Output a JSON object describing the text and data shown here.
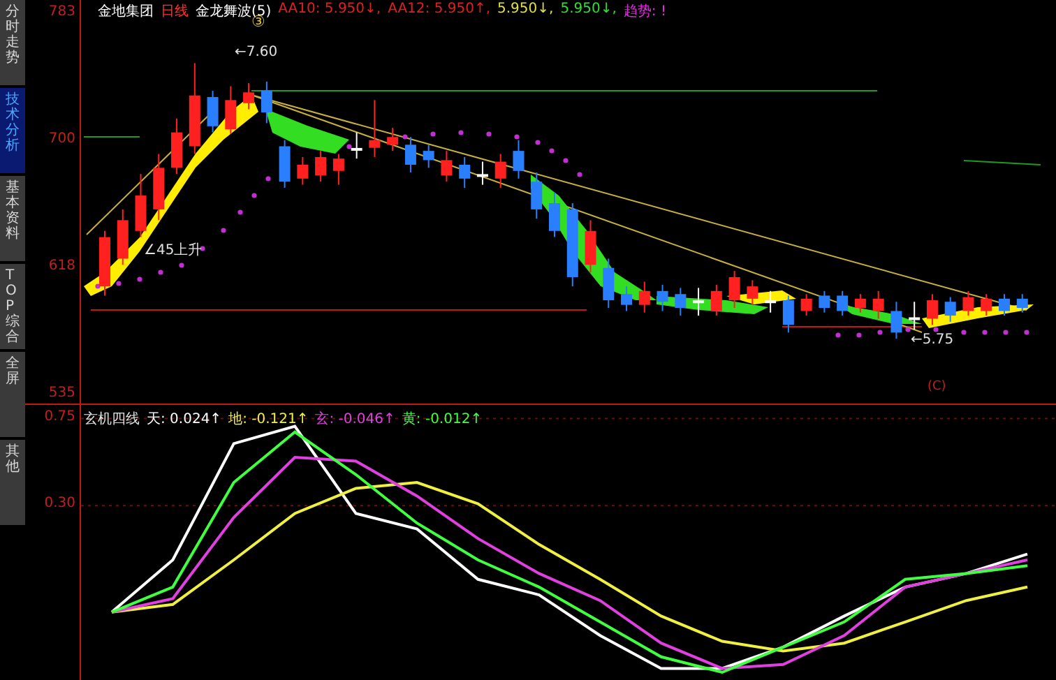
{
  "sidebar": {
    "tabs": [
      {
        "label": "分时走势",
        "selected": false
      },
      {
        "label": "技术分析",
        "selected": true
      },
      {
        "label": "基本资料",
        "selected": false
      },
      {
        "label": "TOP综合",
        "selected": false
      },
      {
        "label": "全屏",
        "selected": false
      },
      {
        "label": "其他",
        "selected": false
      }
    ]
  },
  "main_chart": {
    "header": [
      {
        "text": "金地集团",
        "color": "#ffffff"
      },
      {
        "text": "日线",
        "color": "#ff3030"
      },
      {
        "text": "金龙舞波(5)",
        "color": "#ffffff"
      },
      {
        "text": "AA10: 5.950↓,",
        "color": "#e02020"
      },
      {
        "text": "AA12: 5.950↑,",
        "color": "#e02020"
      },
      {
        "text": "5.950↓,",
        "color": "#e0e040"
      },
      {
        "text": "5.950↓,",
        "color": "#30e030"
      },
      {
        "text": "趋势: !",
        "color": "#e030e0"
      }
    ],
    "marker": "③",
    "annotations": [
      "←7.60",
      "∠45上升",
      "←5.75",
      "(C)"
    ],
    "chart_data": {
      "type": "candlestick",
      "ylim": [
        529,
        792
      ],
      "yticks": [
        {
          "value": 783,
          "label": "783"
        },
        {
          "value": 700,
          "label": "700"
        },
        {
          "value": 618,
          "label": "618"
        },
        {
          "value": 535,
          "label": "535"
        }
      ],
      "ohlc": [
        [
          606,
          642,
          600,
          638
        ],
        [
          624,
          656,
          620,
          649
        ],
        [
          642,
          679,
          638,
          665
        ],
        [
          656,
          692,
          649,
          683
        ],
        [
          683,
          715,
          679,
          706
        ],
        [
          697,
          751,
          692,
          730
        ],
        [
          729,
          733,
          706,
          710
        ],
        [
          708,
          736,
          705,
          727
        ],
        [
          725,
          738,
          721,
          732
        ],
        [
          733,
          739,
          712,
          719
        ],
        [
          697,
          701,
          670,
          674
        ],
        [
          676,
          690,
          672,
          685
        ],
        [
          678,
          694,
          674,
          690
        ],
        [
          681,
          692,
          672,
          689
        ],
        [
          695,
          706,
          689,
          695
        ],
        [
          696,
          727,
          690,
          701
        ],
        [
          698,
          709,
          694,
          703
        ],
        [
          698,
          703,
          680,
          685
        ],
        [
          694,
          698,
          683,
          688
        ],
        [
          678,
          694,
          674,
          688
        ],
        [
          685,
          690,
          670,
          676
        ],
        [
          678,
          687,
          672,
          678
        ],
        [
          676,
          692,
          670,
          687
        ],
        [
          694,
          701,
          676,
          681
        ],
        [
          674,
          680,
          650,
          656
        ],
        [
          660,
          667,
          638,
          642
        ],
        [
          656,
          660,
          606,
          612
        ],
        [
          620,
          649,
          615,
          642
        ],
        [
          618,
          624,
          592,
          597
        ],
        [
          601,
          606,
          590,
          594
        ],
        [
          594,
          609,
          589,
          603
        ],
        [
          603,
          607,
          590,
          596
        ],
        [
          601,
          605,
          587,
          592
        ],
        [
          596,
          605,
          587,
          596
        ],
        [
          590,
          607,
          587,
          603
        ],
        [
          597,
          616,
          592,
          612
        ],
        [
          598,
          610,
          594,
          606
        ],
        [
          596,
          603,
          589,
          596
        ],
        [
          597,
          600,
          576,
          581
        ],
        [
          590,
          601,
          587,
          598
        ],
        [
          600,
          603,
          589,
          592
        ],
        [
          600,
          603,
          587,
          590
        ],
        [
          592,
          601,
          589,
          598
        ],
        [
          590,
          603,
          585,
          598
        ],
        [
          590,
          596,
          572,
          576
        ],
        [
          585,
          596,
          578,
          585
        ],
        [
          585,
          601,
          581,
          597
        ],
        [
          596,
          599,
          583,
          587
        ],
        [
          590,
          603,
          587,
          599
        ],
        [
          590,
          601,
          587,
          598
        ],
        [
          598,
          601,
          587,
          590
        ],
        [
          598,
          601,
          589,
          592
        ]
      ]
    }
  },
  "indicator": {
    "title": "玄机四线",
    "legend": [
      ": 0.024↑",
      ": -0.121↑",
      ": -0.046↑",
      ": -0.012↑"
    ],
    "chart_data": {
      "type": "line",
      "ylim": [
        -0.6,
        0.82
      ],
      "yticks": [
        {
          "value": 0.75,
          "label": "0.75"
        },
        {
          "value": 0.3,
          "label": "0.30"
        }
      ],
      "series": [
        {
          "name": "天",
          "color": "#ffffff",
          "values": [
            -0.25,
            0.02,
            0.62,
            0.71,
            0.26,
            0.18,
            -0.08,
            -0.16,
            -0.37,
            -0.54,
            -0.54,
            -0.43,
            -0.27,
            -0.12,
            -0.05,
            0.05
          ]
        },
        {
          "name": "地",
          "color": "#f0f040",
          "values": [
            -0.25,
            -0.21,
            0.02,
            0.26,
            0.39,
            0.42,
            0.31,
            0.1,
            -0.08,
            -0.27,
            -0.4,
            -0.45,
            -0.41,
            -0.3,
            -0.19,
            -0.12
          ]
        },
        {
          "name": "玄",
          "color": "#e040e0",
          "values": [
            -0.25,
            -0.18,
            0.24,
            0.55,
            0.53,
            0.35,
            0.13,
            -0.05,
            -0.19,
            -0.41,
            -0.54,
            -0.52,
            -0.37,
            -0.12,
            -0.05,
            0.02
          ]
        },
        {
          "name": "黄",
          "color": "#40ff40",
          "values": [
            -0.25,
            -0.12,
            0.42,
            0.68,
            0.46,
            0.21,
            0.02,
            -0.12,
            -0.3,
            -0.48,
            -0.56,
            -0.43,
            -0.3,
            -0.08,
            -0.05,
            -0.01
          ]
        }
      ]
    }
  }
}
